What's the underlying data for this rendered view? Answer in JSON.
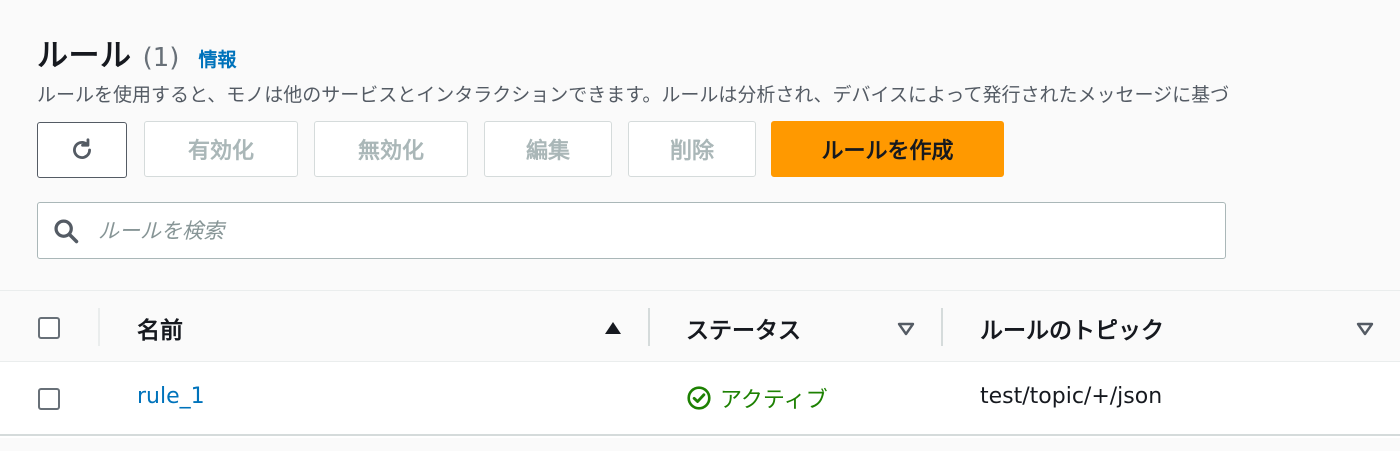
{
  "header": {
    "title": "ルール",
    "count": "(1)",
    "info_link": "情報",
    "description": "ルールを使用すると、モノは他のサービスとインタラクションできます。ルールは分析され、デバイスによって発行されたメッセージに基づ"
  },
  "toolbar": {
    "refresh_icon": "refresh-icon",
    "enable_label": "有効化",
    "disable_label": "無効化",
    "edit_label": "編集",
    "delete_label": "削除",
    "create_label": "ルールを作成",
    "create_color": "#ff9900"
  },
  "search": {
    "placeholder": "ルールを検索",
    "value": "",
    "icon": "search-icon"
  },
  "table": {
    "columns": [
      {
        "label": "名前",
        "sort": "ascending"
      },
      {
        "label": "ステータス",
        "sort": "sortable"
      },
      {
        "label": "ルールのトピック",
        "sort": "sortable"
      }
    ],
    "rows": [
      {
        "name": "rule_1",
        "status": "アクティブ",
        "status_color": "#1d8102",
        "topic": "test/topic/+/json",
        "selected": false
      }
    ]
  }
}
